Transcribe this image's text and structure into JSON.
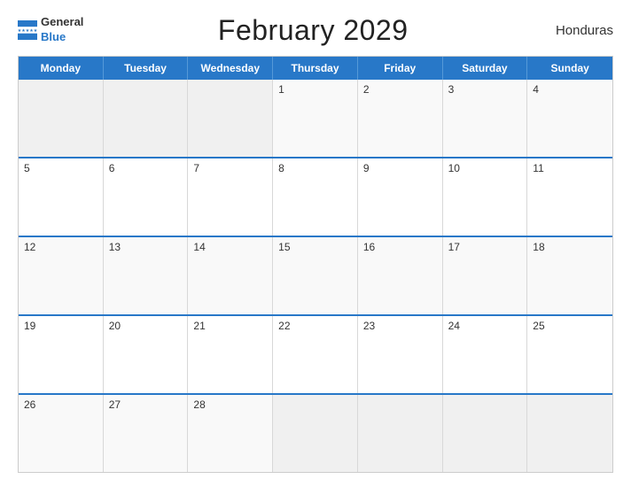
{
  "header": {
    "title": "February 2029",
    "country": "Honduras",
    "logo_general": "General",
    "logo_blue": "Blue"
  },
  "calendar": {
    "days_of_week": [
      "Monday",
      "Tuesday",
      "Wednesday",
      "Thursday",
      "Friday",
      "Saturday",
      "Sunday"
    ],
    "weeks": [
      [
        {
          "day": "",
          "empty": true
        },
        {
          "day": "",
          "empty": true
        },
        {
          "day": "",
          "empty": true
        },
        {
          "day": "1",
          "empty": false
        },
        {
          "day": "2",
          "empty": false
        },
        {
          "day": "3",
          "empty": false
        },
        {
          "day": "4",
          "empty": false
        }
      ],
      [
        {
          "day": "5",
          "empty": false
        },
        {
          "day": "6",
          "empty": false
        },
        {
          "day": "7",
          "empty": false
        },
        {
          "day": "8",
          "empty": false
        },
        {
          "day": "9",
          "empty": false
        },
        {
          "day": "10",
          "empty": false
        },
        {
          "day": "11",
          "empty": false
        }
      ],
      [
        {
          "day": "12",
          "empty": false
        },
        {
          "day": "13",
          "empty": false
        },
        {
          "day": "14",
          "empty": false
        },
        {
          "day": "15",
          "empty": false
        },
        {
          "day": "16",
          "empty": false
        },
        {
          "day": "17",
          "empty": false
        },
        {
          "day": "18",
          "empty": false
        }
      ],
      [
        {
          "day": "19",
          "empty": false
        },
        {
          "day": "20",
          "empty": false
        },
        {
          "day": "21",
          "empty": false
        },
        {
          "day": "22",
          "empty": false
        },
        {
          "day": "23",
          "empty": false
        },
        {
          "day": "24",
          "empty": false
        },
        {
          "day": "25",
          "empty": false
        }
      ],
      [
        {
          "day": "26",
          "empty": false
        },
        {
          "day": "27",
          "empty": false
        },
        {
          "day": "28",
          "empty": false
        },
        {
          "day": "",
          "empty": true
        },
        {
          "day": "",
          "empty": true
        },
        {
          "day": "",
          "empty": true
        },
        {
          "day": "",
          "empty": true
        }
      ]
    ]
  }
}
